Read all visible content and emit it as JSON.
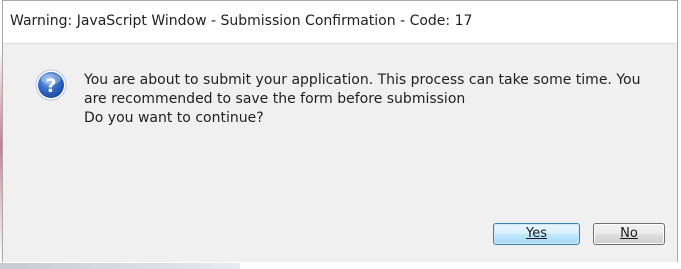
{
  "dialog": {
    "title": "Warning: JavaScript Window - Submission Confirmation - Code: 17",
    "icon": "question-icon",
    "message_lines": [
      "You are about to submit your application. This process can take some time. You",
      "are recommended to save the form before submission",
      "Do you want to continue?"
    ]
  },
  "buttons": {
    "yes_label": "Yes",
    "no_label": "No"
  },
  "colors": {
    "icon_blue": "#2a5fb8",
    "default_button_border": "#3c7fb1",
    "dialog_background": "#f0f0f0"
  }
}
